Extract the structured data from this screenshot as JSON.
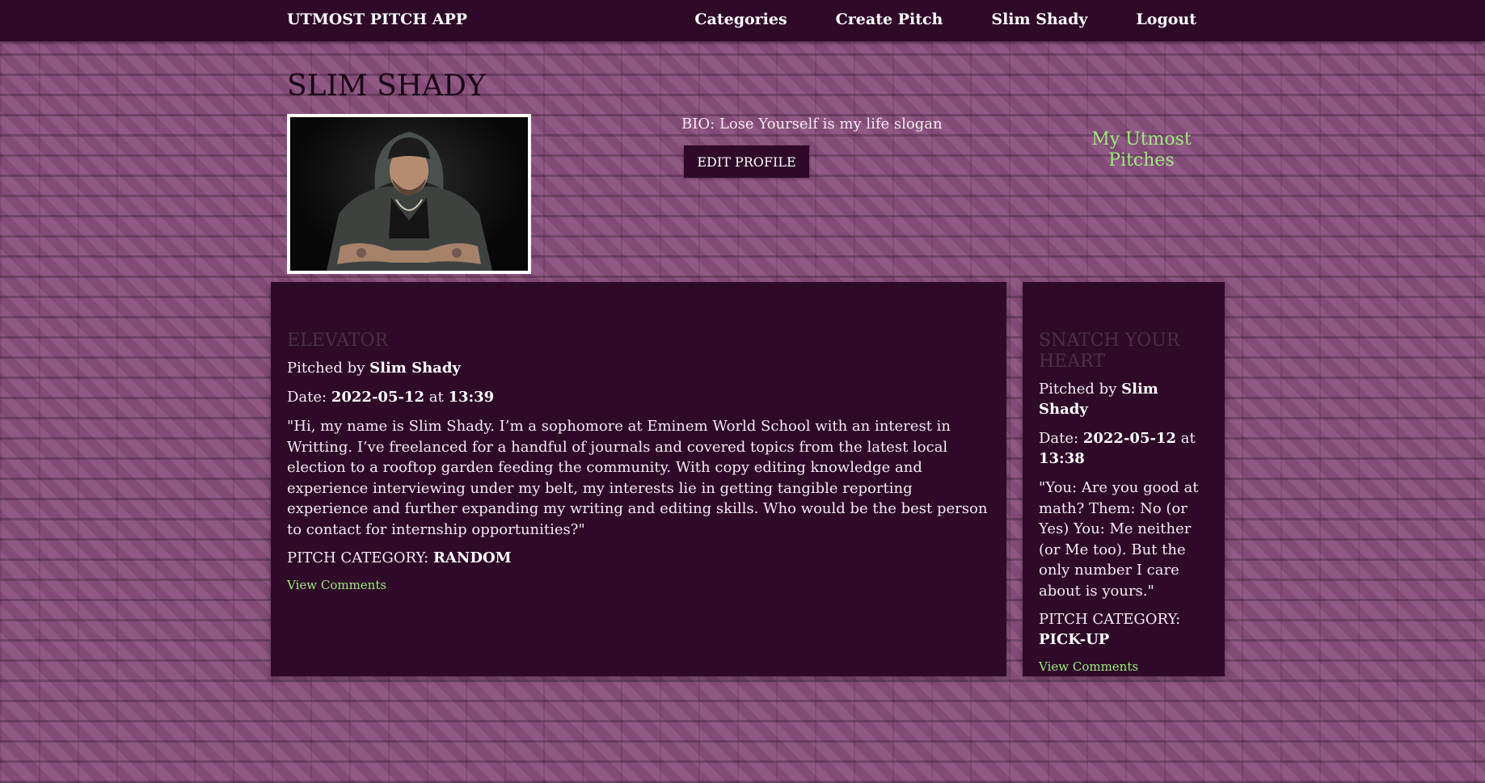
{
  "navbar": {
    "brand": "UTMOST PITCH APP",
    "links": [
      "Categories",
      "Create Pitch",
      "Slim Shady",
      "Logout"
    ]
  },
  "profile": {
    "name": "SLIM SHADY",
    "bio": "BIO: Lose Yourself is my life slogan",
    "edit_label": "EDIT PROFILE",
    "my_pitches_label": "My Utmost Pitches"
  },
  "pitches": [
    {
      "title": "ELEVATOR",
      "pitched_by_label": "Pitched by",
      "author": "Slim Shady",
      "date_label": "Date:",
      "date": "2022-05-12",
      "at_label": "at",
      "time": "13:39",
      "body": "\"Hi, my name is Slim Shady. I’m a sophomore at Eminem World School with an interest in Writting. I’ve freelanced for a handful of journals and covered topics from the latest local election to a rooftop garden feeding the community. With copy editing knowledge and experience interviewing under my belt, my interests lie in getting tangible reporting experience and further expanding my writing and editing skills. Who would be the best person to contact for internship opportunities?\"",
      "category_label": "PITCH CATEGORY:",
      "category": "RANDOM",
      "comments_label": "View Comments"
    },
    {
      "title": "SNATCH YOUR HEART",
      "pitched_by_label": "Pitched by",
      "author": "Slim Shady",
      "date_label": "Date:",
      "date": "2022-05-12",
      "at_label": "at",
      "time": "13:38",
      "body": "\"You: Are you good at math? Them: No (or Yes) You: Me neither (or Me too). But the only number I care about is yours.\"",
      "category_label": "PITCH CATEGORY:",
      "category": "PICK-UP",
      "comments_label": "View Comments"
    }
  ],
  "colors": {
    "nav_bg": "#2e0a28",
    "card_bg": "#2e0a28",
    "accent_green": "#9eea7f",
    "page_bg": "#8a4f7d"
  }
}
